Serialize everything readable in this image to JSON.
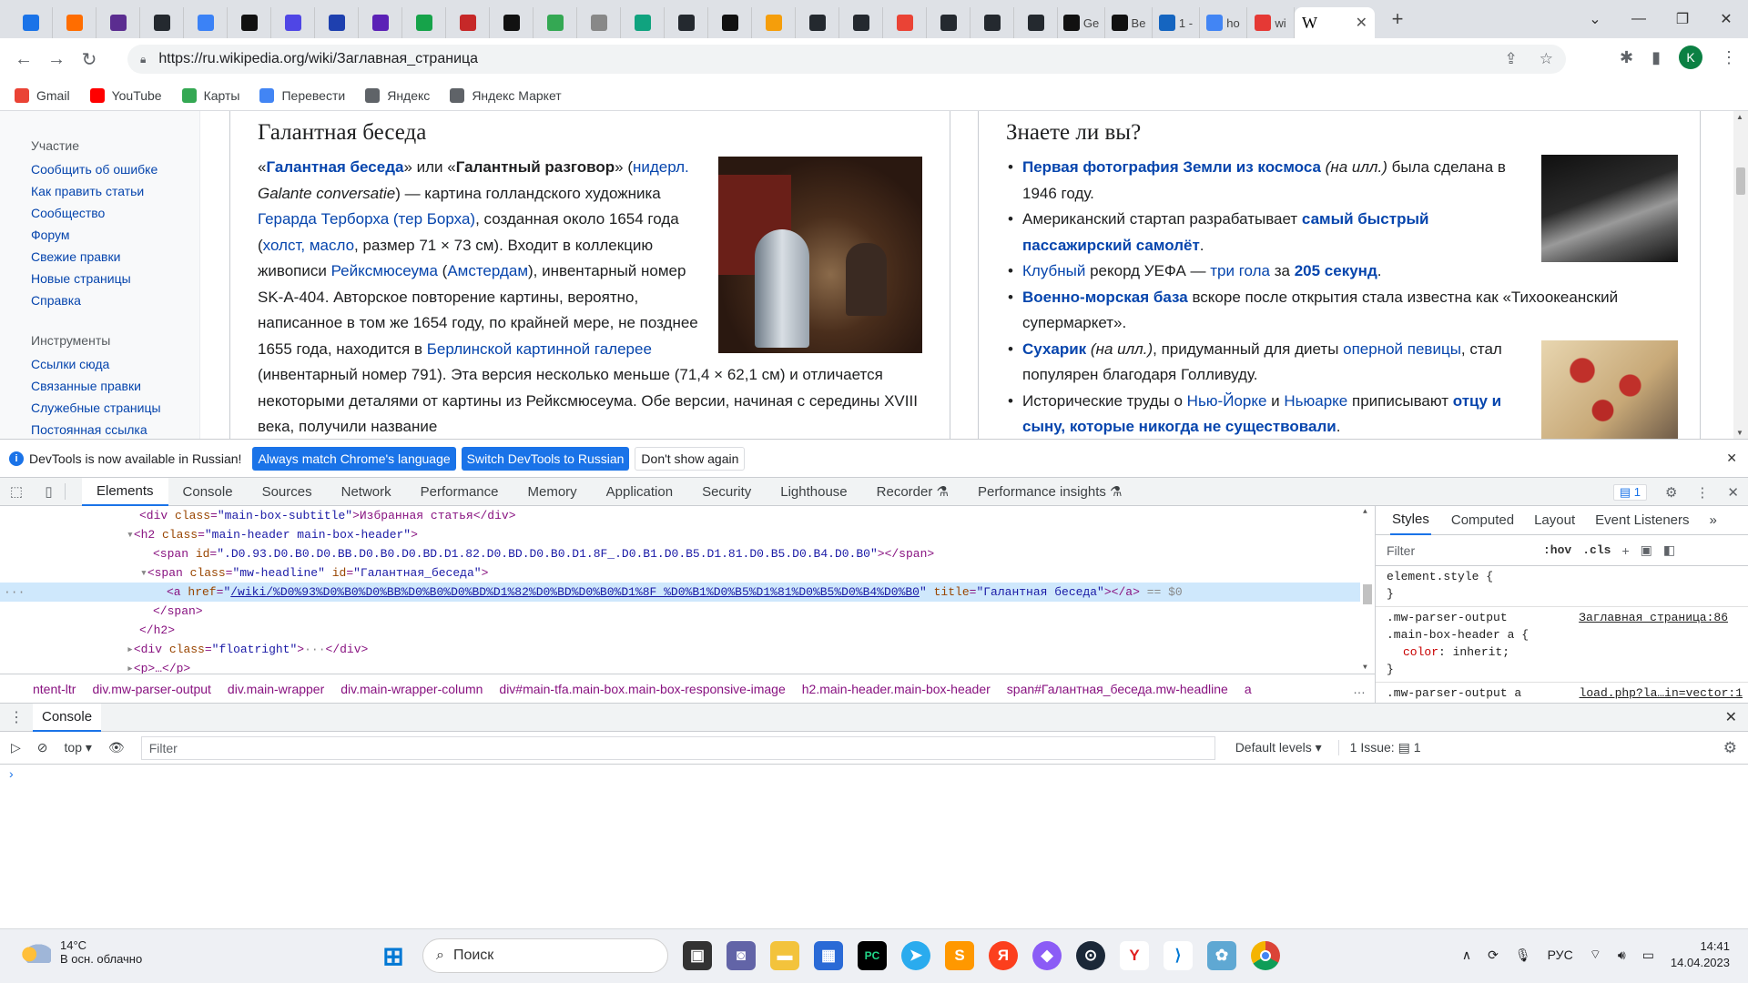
{
  "browser": {
    "tabs": [
      {
        "title": "",
        "color": "#1a73e8"
      },
      {
        "title": "",
        "color": "#ff6d00"
      },
      {
        "title": "",
        "color": "#5b2d90"
      },
      {
        "title": "",
        "color": "#24292f"
      },
      {
        "title": "",
        "color": "#3b82f6"
      },
      {
        "title": "",
        "color": "#111111"
      },
      {
        "title": "",
        "color": "#4f46e5"
      },
      {
        "title": "",
        "color": "#1e40af"
      },
      {
        "title": "",
        "color": "#5b21b6"
      },
      {
        "title": "",
        "color": "#16a34a"
      },
      {
        "title": "",
        "color": "#c62828"
      },
      {
        "title": "",
        "color": "#111111"
      },
      {
        "title": "",
        "color": "#34a853"
      },
      {
        "title": "",
        "color": "#888888"
      },
      {
        "title": "",
        "color": "#10a37f"
      },
      {
        "title": "",
        "color": "#24292f"
      },
      {
        "title": "",
        "color": "#111111"
      },
      {
        "title": "",
        "color": "#f59e0b"
      },
      {
        "title": "",
        "color": "#24292f"
      },
      {
        "title": "",
        "color": "#24292f"
      },
      {
        "title": "",
        "color": "#ea4335"
      },
      {
        "title": "",
        "color": "#24292f"
      },
      {
        "title": "",
        "color": "#24292f"
      },
      {
        "title": "",
        "color": "#24292f"
      },
      {
        "title": "Ge",
        "color": "#111111"
      },
      {
        "title": "Be",
        "color": "#111111"
      },
      {
        "title": "1 -",
        "color": "#1565c0"
      },
      {
        "title": "ho",
        "color": "#4285f4"
      },
      {
        "title": "wi",
        "color": "#e53935"
      }
    ],
    "active_tab": {
      "title": "W",
      "close": "✕"
    },
    "new_tab": "+",
    "window_controls": [
      "⌄",
      "—",
      "❐",
      "✕"
    ],
    "url": "https://ru.wikipedia.org/wiki/Заглавная_страница",
    "profile_initial": "K",
    "bookmarks": [
      {
        "label": "Gmail",
        "color": "#ea4335"
      },
      {
        "label": "YouTube",
        "color": "#ff0000"
      },
      {
        "label": "Карты",
        "color": "#34a853"
      },
      {
        "label": "Перевести",
        "color": "#4285f4"
      },
      {
        "label": "Яндекс",
        "color": "#5f6368"
      },
      {
        "label": "Яндекс Маркет",
        "color": "#5f6368"
      }
    ]
  },
  "wiki": {
    "sidebar": {
      "section1": "Участие",
      "links1": [
        "Сообщить об ошибке",
        "Как править статьи",
        "Сообщество",
        "Форум",
        "Свежие правки",
        "Новые страницы",
        "Справка"
      ],
      "section2": "Инструменты",
      "links2": [
        "Ссылки сюда",
        "Связанные правки",
        "Служебные страницы",
        "Постоянная ссылка"
      ]
    },
    "left": {
      "heading": "Галантная беседа",
      "p1": "«",
      "a1": "Галантная беседа",
      "p2": "» или «",
      "b1": "Галантный разговор",
      "p3": "» (",
      "a2": "нидерл.",
      "p4": " ",
      "i1": "Galante conversatie",
      "p5": ") — картина голландского художника ",
      "a3": "Герарда Терборха (тер Борха)",
      "p6": ", созданная около 1654 года (",
      "a4": "холст, масло",
      "p7": ", размер 71 × 73 см). Входит в коллекцию живописи ",
      "a5": "Рейксмюсеума",
      "p8": " (",
      "a6": "Амстердам",
      "p9": "), инвентарный номер SK-A-404. Авторское повторение картины, вероятно, написанное в том же 1654 году, по крайней мере, не позднее 1655 года, находится в ",
      "a7": "Берлинской картинной галерее",
      "p10": " (инвентарный номер 791). Эта версия несколько меньше (71,4 × 62,1 см) и отличается некоторыми деталями от картины из Рейксмюсеума. Обе версии, начиная с середины XVIII века, получили название"
    },
    "right": {
      "heading": "Знаете ли вы?",
      "i1a": "Первая фотография Земли из космоса",
      "i1b": " (на илл.)",
      "i1c": " была сделана в 1946 году.",
      "i2a": "Американский стартап разрабатывает ",
      "i2b": "самый быстрый пассажирский самолёт",
      "i2c": ".",
      "i3a": "Клубный",
      "i3b": " рекорд УЕФА — ",
      "i3c": "три гола",
      "i3d": " за ",
      "i3e": "205 секунд",
      "i3f": ".",
      "i4a": "Военно-морская база",
      "i4b": " вскоре после открытия стала известна как «Тихоокеанский супермаркет».",
      "i5a": "Сухарик",
      "i5b": " (на илл.)",
      "i5c": ", придуманный для диеты ",
      "i5d": "оперной певицы",
      "i5e": ", стал популярен благодаря Голливуду.",
      "i6a": "Исторические труды о ",
      "i6b": "Нью-Йорке",
      "i6c": " и ",
      "i6d": "Ньюарке",
      "i6e": " приписывают ",
      "i6f": "отцу и сыну, которые никогда не существовали",
      "i6g": "."
    }
  },
  "devtools": {
    "infobar": {
      "message": "DevTools is now available in Russian!",
      "btn1": "Always match Chrome's language",
      "btn2": "Switch DevTools to Russian",
      "btn3": "Don't show again"
    },
    "tabs": [
      "Elements",
      "Console",
      "Sources",
      "Network",
      "Performance",
      "Memory",
      "Application",
      "Security",
      "Lighthouse",
      "Recorder ⚗",
      "Performance insights ⚗"
    ],
    "issues_count": "1",
    "dom": {
      "l1_tag": "<div ",
      "l1_an": "class",
      "l1_av": "\"main-box-subtitle\"",
      "l1_txt": ">Избранная статья</div>",
      "l2_tag": "<h2 ",
      "l2_an": "class",
      "l2_av": "\"main-header main-box-header\"",
      "l2_end": ">",
      "l3_tag": "<span ",
      "l3_an": "id",
      "l3_av": "\".D0.93.D0.B0.D0.BB.D0.B0.D0.BD.D1.82.D0.BD.D0.B0.D1.8F_.D0.B1.D0.B5.D1.81.D0.B5.D0.B4.D0.B0\"",
      "l3_end": "></span>",
      "l4_tag": "<span ",
      "l4_an1": "class",
      "l4_av1": "\"mw-headline\"",
      "l4_an2": "id",
      "l4_av2": "\"Галантная_беседа\"",
      "l4_end": ">",
      "l5_tag": "<a ",
      "l5_an1": "href",
      "l5_href": "/wiki/%D0%93%D0%B0%D0%BB%D0%B0%D0%BD%D1%82%D0%BD%D0%B0%D1%8F_%D0%B1%D0%B5%D1%81%D0%B5%D0%B4%D0%B0",
      "l5_an2": "title",
      "l5_av2": "\"Галантная беседа\"",
      "l5_end": "></a>",
      "l5_eq": " == $0",
      "l6": "</span>",
      "l7": "</h2>",
      "l8_tag": "<div ",
      "l8_an": "class",
      "l8_av": "\"floatright\"",
      "l8_end": "></div>",
      "l9": "<p>…</p>"
    },
    "breadcrumbs": [
      "ntent-ltr",
      "div.mw-parser-output",
      "div.main-wrapper",
      "div.main-wrapper-column",
      "div#main-tfa.main-box.main-box-responsive-image",
      "h2.main-header.main-box-header",
      "span#Галантная_беседа.mw-headline",
      "a"
    ],
    "styles": {
      "tabs": [
        "Styles",
        "Computed",
        "Layout",
        "Event Listeners",
        "»"
      ],
      "filter_placeholder": "Filter",
      "hov": ":hov",
      "cls": ".cls",
      "rule1_sel": "element.style {",
      "rule1_end": "}",
      "rule2_sel1": ".mw-parser-output",
      "rule2_sel2": ".main-box-header a {",
      "rule2_src": "Заглавная_страница:86",
      "rule2_prop": "color",
      "rule2_val": ": inherit;",
      "rule2_end": "}",
      "rule3_sel": ".mw-parser-output a",
      "rule3_src": "load.php?la…in=vector:1"
    },
    "console": {
      "title": "Console",
      "context": "top ▾",
      "filter_placeholder": "Filter",
      "levels": "Default levels ▾",
      "issues": "1 Issue: ▤ 1",
      "prompt": "›"
    }
  },
  "taskbar": {
    "temp": "14°C",
    "weather": "В осн. облачно",
    "search": "Поиск",
    "lang": "РУС",
    "time": "14:41",
    "date": "14.04.2023"
  }
}
